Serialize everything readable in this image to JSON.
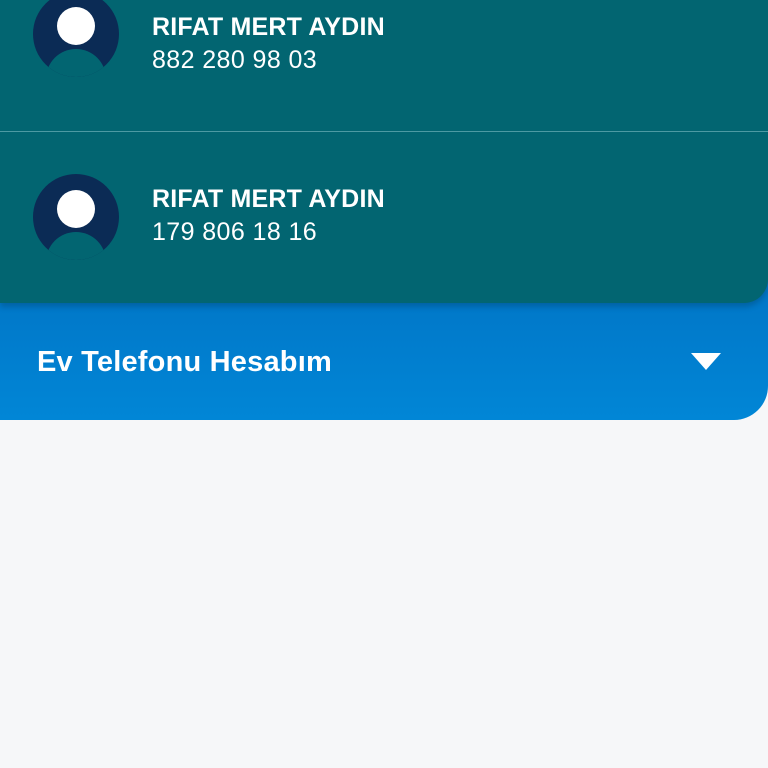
{
  "accounts": [
    {
      "name": "RIFAT MERT AYDIN",
      "number": "882 280 98 03",
      "avatar_icon": "user-avatar-icon"
    },
    {
      "name": "RIFAT MERT AYDIN",
      "number": "179 806 18 16",
      "avatar_icon": "user-avatar-icon"
    }
  ],
  "section": {
    "title": "Ev Telefonu Hesabım",
    "toggle_icon": "caret-down-icon"
  },
  "colors": {
    "account_list_bg": "#026571",
    "avatar_bg": "#0b2b55",
    "section_bg": "#0180d0",
    "page_bg": "#f6f7f9"
  }
}
